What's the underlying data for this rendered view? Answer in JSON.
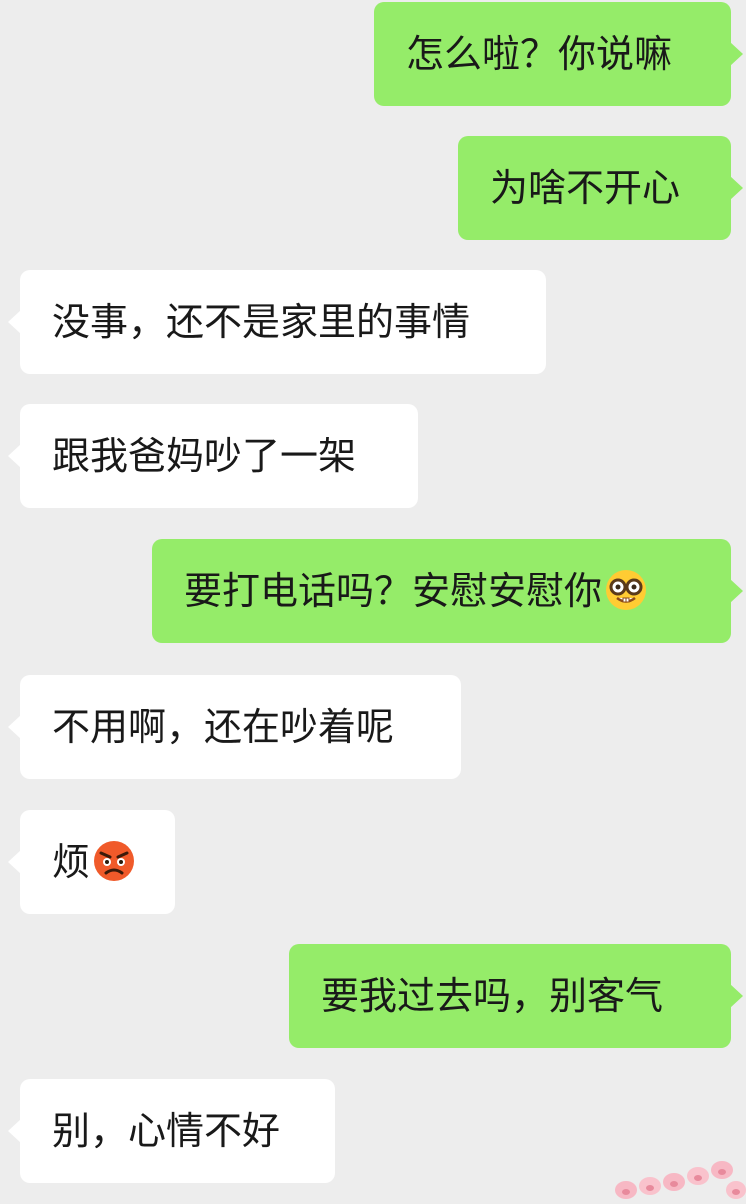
{
  "messages": [
    {
      "side": "sent",
      "text": "怎么啦？你说嘛"
    },
    {
      "side": "sent",
      "text": "为啥不开心"
    },
    {
      "side": "recv",
      "text": "没事，还不是家里的事情"
    },
    {
      "side": "recv",
      "text": "跟我爸妈吵了一架"
    },
    {
      "side": "sent",
      "text": "要打电话吗？安慰安慰你",
      "emoji": "nerd-face-icon"
    },
    {
      "side": "recv",
      "text": "不用啊，还在吵着呢"
    },
    {
      "side": "recv",
      "text": "烦",
      "emoji": "angry-face-icon"
    },
    {
      "side": "sent",
      "text": "要我过去吗，别客气"
    },
    {
      "side": "recv",
      "text": "别，心情不好"
    }
  ],
  "colors": {
    "background": "#ededed",
    "sent_bubble": "#95ec69",
    "received_bubble": "#ffffff",
    "text": "#191919"
  }
}
